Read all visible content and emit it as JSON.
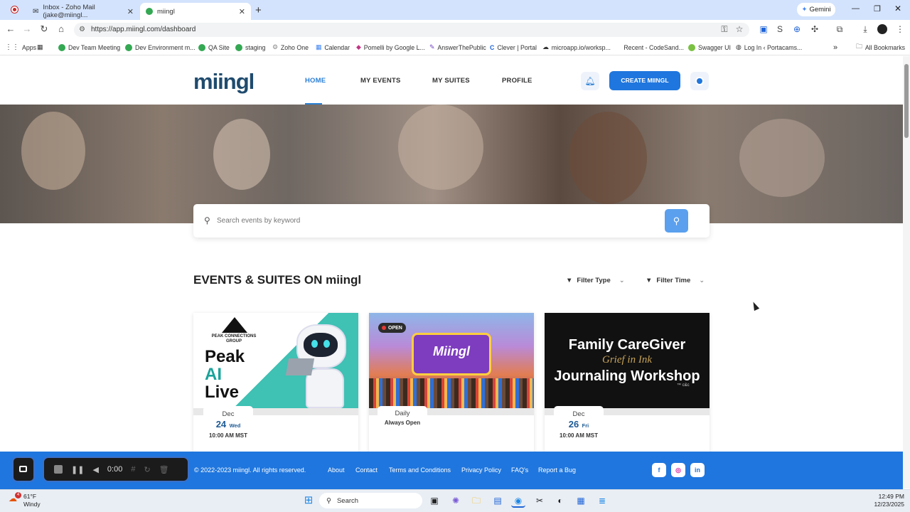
{
  "browser": {
    "tabs": [
      {
        "title": "Inbox - Zoho Mail (jake@miingl...",
        "icon": "mail-icon"
      },
      {
        "title": "miingl",
        "icon": "miingl-favicon"
      }
    ],
    "new_tab": "+",
    "gemini_label": "Gemini",
    "url": "https://app.miingl.com/dashboard",
    "bookmarks": [
      {
        "label": "Apps",
        "color": "#4285f4"
      },
      {
        "label": "",
        "color": "#555555"
      },
      {
        "label": "Dev Team Meeting",
        "color": "#34a853"
      },
      {
        "label": "Dev Environment m...",
        "color": "#34a853"
      },
      {
        "label": "QA Site",
        "color": "#34a853"
      },
      {
        "label": "staging",
        "color": "#34a853"
      },
      {
        "label": "Zoho One",
        "color": "#888888"
      },
      {
        "label": "Calendar",
        "color": "#4285f4"
      },
      {
        "label": "Pomelli by Google L...",
        "color": "#c13584"
      },
      {
        "label": "AnswerThePublic",
        "color": "#6f42c1"
      },
      {
        "label": "Clever | Portal",
        "color": "#1e63d6"
      },
      {
        "label": "microapp.io/worksp...",
        "color": "#222222"
      },
      {
        "label": "Recent - CodeSand...",
        "color": "#ffffff"
      },
      {
        "label": "Swagger UI",
        "color": "#7ac143"
      },
      {
        "label": "Log In ‹ Portacams...",
        "color": "#555555"
      }
    ],
    "more_bookmarks": "»",
    "all_bookmarks": "All Bookmarks"
  },
  "app": {
    "logo": "miingl",
    "nav": [
      "HOME",
      "MY EVENTS",
      "MY SUITES",
      "PROFILE"
    ],
    "create_button": "CREATE MIINGL",
    "search_placeholder": "Search events by keyword",
    "section_title": "EVENTS & SUITES ON miingl",
    "filters": [
      "Filter Type",
      "Filter Time"
    ],
    "cards": [
      {
        "image_lines": [
          "Peak",
          "AI",
          "Live"
        ],
        "image_brand": "PEAK CONNECTIONS GROUP",
        "month": "Dec",
        "day": "24",
        "dow": "Wed",
        "time": "10:00 AM MST"
      },
      {
        "badge": "OPEN",
        "image_text": "Miingl",
        "month": "Daily",
        "day": "",
        "dow": "",
        "time": "Always Open"
      },
      {
        "image_lines": [
          "Family CareGiver",
          "Grief in Ink",
          "Journaling Workshop"
        ],
        "image_sub": "™ c&c",
        "month": "Dec",
        "day": "26",
        "dow": "Fri",
        "time": "10:00 AM MST"
      }
    ],
    "footer": {
      "copyright": "© 2022-2023 miingl. All rights reserved.",
      "links": [
        "About",
        "Contact",
        "Terms and Conditions",
        "Privacy Policy",
        "FAQ's",
        "Report a Bug"
      ]
    }
  },
  "recorder": {
    "time": "0:00"
  },
  "taskbar": {
    "weather_temp": "61°F",
    "weather_desc": "Windy",
    "search_placeholder": "Search",
    "time": "12:49 PM",
    "date": "12/23/2025"
  },
  "colors": {
    "brand": "#1f76de",
    "tab_strip": "#d3e3fd"
  }
}
